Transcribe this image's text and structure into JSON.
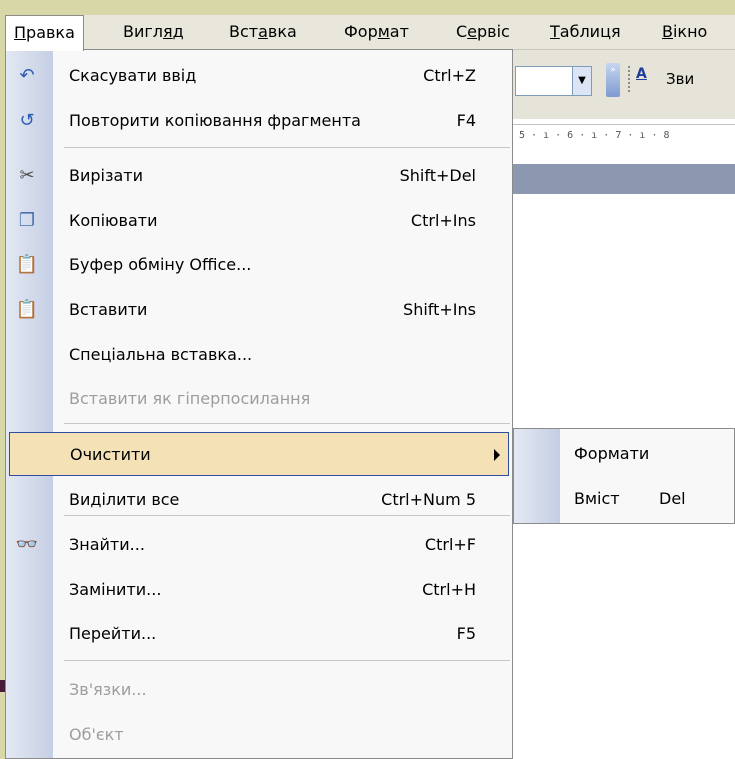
{
  "menubar": [
    {
      "label": "Правка",
      "mnemonic_index": 0,
      "active": true
    },
    {
      "label": "Вигляд",
      "mnemonic_index": 4
    },
    {
      "label": "Вставка",
      "mnemonic_index": 3
    },
    {
      "label": "Формат",
      "mnemonic_index": 3
    },
    {
      "label": "Сервіс",
      "mnemonic_index": 1
    },
    {
      "label": "Таблиця",
      "mnemonic_index": 0
    },
    {
      "label": "Вікно",
      "mnemonic_index": 0
    }
  ],
  "toolbar": {
    "style_text": "Зви",
    "style_icon_label": "A",
    "grip_glyph": "»"
  },
  "ruler": {
    "text": "5 · ı · 6 · ı · 7 · ı · 8"
  },
  "edit_menu": {
    "items": [
      {
        "id": "undo",
        "label": "Скасувати ввід",
        "shortcut": "Ctrl+Z",
        "icon": "undo-icon",
        "glyph": "↶",
        "color": "#2d5bb5"
      },
      {
        "id": "redo",
        "label": "Повторити копіювання фрагмента",
        "shortcut": "F4",
        "icon": "repeat-icon",
        "glyph": "↺",
        "color": "#2d5bb5"
      },
      {
        "id": "cut",
        "label": "Вирізати",
        "shortcut": "Shift+Del",
        "icon": "scissors-icon",
        "glyph": "✂",
        "color": "#505050"
      },
      {
        "id": "copy",
        "label": "Копіювати",
        "shortcut": "Ctrl+Ins",
        "icon": "copy-icon",
        "glyph": "❐",
        "color": "#4a6fb0"
      },
      {
        "id": "clipboard",
        "label": "Буфер обміну Office...",
        "shortcut": "",
        "icon": "office-clipboard-icon",
        "glyph": "📋",
        "color": "#b08a2a"
      },
      {
        "id": "paste",
        "label": "Вставити",
        "shortcut": "Shift+Ins",
        "icon": "paste-icon",
        "glyph": "📋",
        "color": "#b08a2a"
      },
      {
        "id": "paste_special",
        "label": "Спеціальна вставка...",
        "shortcut": "",
        "icon": "",
        "glyph": "",
        "color": ""
      },
      {
        "id": "paste_hyperlink",
        "label": "Вставити як гіперпосилання",
        "shortcut": "",
        "icon": "",
        "glyph": "",
        "color": "",
        "disabled": true
      },
      {
        "id": "clear",
        "label": "Очистити",
        "shortcut": "",
        "icon": "",
        "glyph": "",
        "color": "",
        "submenu": true,
        "highlighted": true
      },
      {
        "id": "select_all",
        "label": "Виділити все",
        "shortcut": "Ctrl+Num 5",
        "icon": "",
        "glyph": "",
        "color": ""
      },
      {
        "id": "find",
        "label": "Знайти...",
        "shortcut": "Ctrl+F",
        "icon": "binoculars-icon",
        "glyph": "👓",
        "color": "#333"
      },
      {
        "id": "replace",
        "label": "Замінити...",
        "shortcut": "Ctrl+H",
        "icon": "",
        "glyph": "",
        "color": ""
      },
      {
        "id": "goto",
        "label": "Перейти...",
        "shortcut": "F5",
        "icon": "",
        "glyph": "",
        "color": ""
      },
      {
        "id": "links",
        "label": "Зв'язки...",
        "shortcut": "",
        "icon": "",
        "glyph": "",
        "color": "",
        "disabled": true
      },
      {
        "id": "object",
        "label": "Об'єкт",
        "shortcut": "",
        "icon": "",
        "glyph": "",
        "color": "",
        "disabled": true
      }
    ]
  },
  "clear_submenu": {
    "items": [
      {
        "id": "formats",
        "label": "Формати",
        "shortcut": ""
      },
      {
        "id": "contents",
        "label": "Вміст",
        "shortcut": "Del"
      }
    ]
  },
  "colors": {
    "highlight_bg": "#f4e2b6",
    "highlight_border": "#2d4ea0",
    "menu_bg": "#f8f8f8",
    "disabled_text": "#9d9d9d"
  }
}
